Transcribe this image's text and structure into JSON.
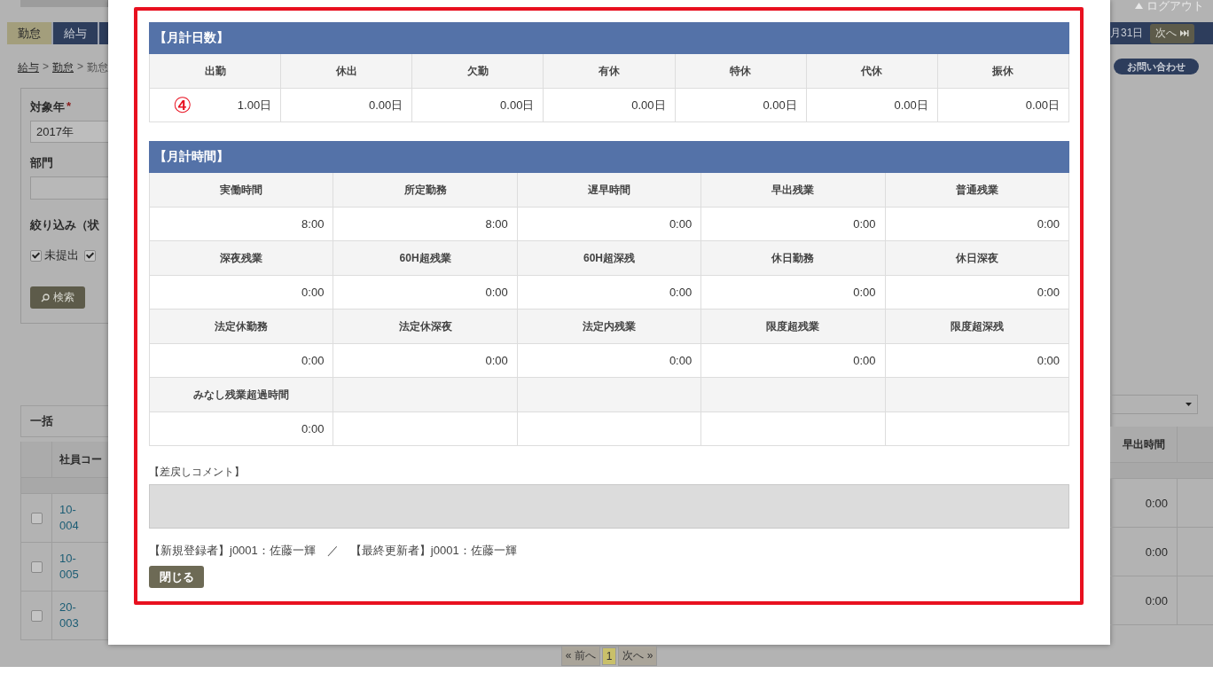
{
  "header": {
    "logout": "ログアウト",
    "date": "月31日",
    "next_button": "次へ"
  },
  "nav": [
    {
      "label": "勤怠",
      "selected": true
    },
    {
      "label": "給与",
      "selected": false
    }
  ],
  "breadcrumb": [
    {
      "label": "給与",
      "sep": ">"
    },
    {
      "label": "勤怠",
      "sep": ">"
    },
    {
      "label": "勤怠"
    }
  ],
  "contact_button": "お問い合わせ",
  "filter": {
    "year_label": "対象年",
    "required_mark": "*",
    "year_value": "2017年",
    "dept_label": "部門",
    "narrow_label": "絞り込み（状",
    "checkboxes": [
      {
        "label": "未提出",
        "checked": true
      },
      {
        "checked": true
      }
    ],
    "search_button": "検索"
  },
  "bulk": {
    "label": "一括"
  },
  "list": {
    "columns": [
      "社員コー",
      "早出時間"
    ],
    "rows": [
      {
        "checked": false,
        "code": "10-004",
        "early": "0:00"
      },
      {
        "checked": false,
        "code": "10-005",
        "early": "0:00"
      },
      {
        "checked": false,
        "code": "20-003",
        "early": "0:00"
      }
    ]
  },
  "modal": {
    "days": {
      "title": "【月計日数】",
      "annotation": "④",
      "items": [
        {
          "label": "出勤",
          "value": "1.00日"
        },
        {
          "label": "休出",
          "value": "0.00日"
        },
        {
          "label": "欠勤",
          "value": "0.00日"
        },
        {
          "label": "有休",
          "value": "0.00日"
        },
        {
          "label": "特休",
          "value": "0.00日"
        },
        {
          "label": "代休",
          "value": "0.00日"
        },
        {
          "label": "振休",
          "value": "0.00日"
        }
      ]
    },
    "times": {
      "title": "【月計時間】",
      "items": [
        {
          "label": "実働時間",
          "value": "8:00"
        },
        {
          "label": "所定勤務",
          "value": "8:00"
        },
        {
          "label": "遅早時間",
          "value": "0:00"
        },
        {
          "label": "早出残業",
          "value": "0:00"
        },
        {
          "label": "普通残業",
          "value": "0:00"
        },
        {
          "label": "深夜残業",
          "value": "0:00"
        },
        {
          "label": "60H超残業",
          "value": "0:00"
        },
        {
          "label": "60H超深残",
          "value": "0:00"
        },
        {
          "label": "休日勤務",
          "value": "0:00"
        },
        {
          "label": "休日深夜",
          "value": "0:00"
        },
        {
          "label": "法定休勤務",
          "value": "0:00"
        },
        {
          "label": "法定休深夜",
          "value": "0:00"
        },
        {
          "label": "法定内残業",
          "value": "0:00"
        },
        {
          "label": "限度超残業",
          "value": "0:00"
        },
        {
          "label": "限度超深残",
          "value": "0:00"
        },
        {
          "label": "みなし残業超過時間",
          "value": "0:00"
        }
      ]
    },
    "comment_label": "【差戻しコメント】",
    "footer": "【新規登録者】j0001：佐藤一輝　／　【最終更新者】j0001：佐藤一輝",
    "close_button": "閉じる"
  },
  "pagination": {
    "prev": "« 前へ",
    "pages": [
      {
        "label": "1",
        "selected": true
      }
    ],
    "next": "次へ »"
  }
}
